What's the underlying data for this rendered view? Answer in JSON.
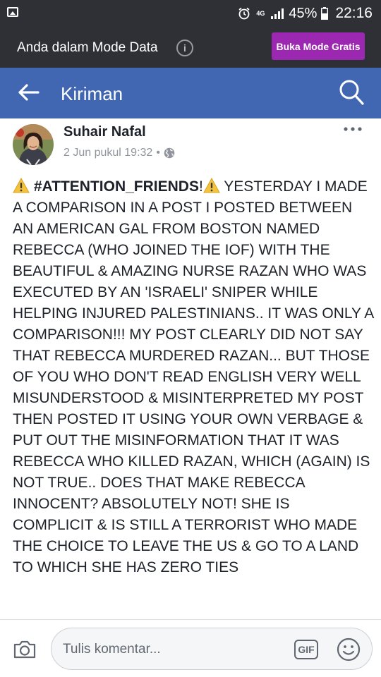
{
  "status_bar": {
    "network": "4G",
    "battery_percent": "45%",
    "time": "22:16"
  },
  "data_mode": {
    "text": "Anda dalam Mode Data",
    "button_label": "Buka Mode Gratis",
    "info_icon": "i"
  },
  "header": {
    "title": "Kiriman"
  },
  "post": {
    "author": "Suhair Nafal",
    "timestamp": "2 Jun pukul 19:32",
    "separator": "•",
    "hashtag": "#ATTENTION_FRIENDS",
    "exclaim": "!",
    "text": " YESTERDAY I MADE A COMPARISON IN A POST I POSTED BETWEEN AN AMERICAN GAL FROM BOSTON NAMED REBECCA (WHO JOINED THE IOF) WITH THE BEAUTIFUL & AMAZING NURSE RAZAN WHO WAS EXECUTED BY AN 'ISRAELI' SNIPER WHILE HELPING INJURED PALESTINIANS.. IT WAS ONLY A COMPARISON!!! MY POST CLEARLY DID NOT SAY THAT REBECCA MURDERED RAZAN... BUT THOSE OF YOU WHO DON'T READ ENGLISH VERY WELL MISUNDERSTOOD & MISINTERPRETED MY POST THEN POSTED IT USING YOUR OWN VERBAGE & PUT OUT THE MISINFORMATION THAT IT WAS REBECCA WHO KILLED RAZAN, WHICH (AGAIN) IS NOT TRUE.. DOES THAT MAKE REBECCA INNOCENT? ABSOLUTELY NOT! SHE IS COMPLICIT & IS STILL A TERRORIST WHO MADE THE CHOICE TO LEAVE THE US & GO TO A LAND TO WHICH SHE HAS ZERO TIES"
  },
  "comment_bar": {
    "placeholder": "Tulis komentar...",
    "gif_label": "GIF"
  },
  "colors": {
    "header_blue": "#4267b2",
    "dark_bar": "#2f3036",
    "purple_button": "#9c27b0"
  },
  "icons": [
    "gallery-icon",
    "alarm-icon",
    "signal-icon",
    "battery-icon",
    "info-icon",
    "back-arrow-icon",
    "search-icon",
    "more-options-icon",
    "globe-icon",
    "warning-icon",
    "camera-icon",
    "gif-icon",
    "emoji-icon"
  ]
}
